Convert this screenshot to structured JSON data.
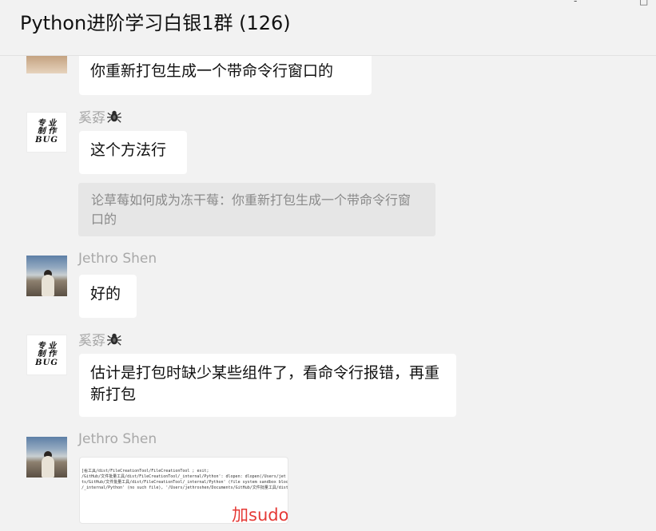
{
  "window": {
    "title": "Python进阶学习白银1群 (126)",
    "controls": [
      "-",
      "□"
    ]
  },
  "messages": [
    {
      "sender": "",
      "avatar": "cropped-photo-avatar",
      "text": "你重新打包生成一个带命令行窗口的"
    },
    {
      "sender": "奚孬",
      "avatar_text": [
        "专 业",
        "制 作",
        "BUG"
      ],
      "badge": "spider-icon",
      "text": "这个方法行",
      "quote": "论草莓如何成为冻干莓：你重新打包生成一个带命令行窗口的"
    },
    {
      "sender": "Jethro Shen",
      "avatar": "mountain-photo-avatar",
      "text": "好的"
    },
    {
      "sender": "奚孬",
      "avatar_text": [
        "专 业",
        "制 作",
        "BUG"
      ],
      "badge": "spider-icon",
      "text": "估计是打包时缺少某些组件了，看命令行报错，再重新打包"
    },
    {
      "sender": "Jethro Shen",
      "avatar": "mountain-photo-avatar",
      "image": {
        "code_lines": [
          "[看工具/dist/FileCreationTool/FileCreationTool ; exit;",
          "/GitHub/文件批量工具/dist/FileCreationTool/_internal/Python': dlopen: dlopen(/Users/jet",
          "ts/GitHub/文件批量工具/dist/FileCreationTool/_internal/Python' (file system sandbox bloc",
          "/_internal/Python' (no such file), '/Users/jethroshen/Documents/GitHub/文件批量工具/dist"
        ],
        "annotation": "加sudo 更改权限"
      }
    }
  ]
}
